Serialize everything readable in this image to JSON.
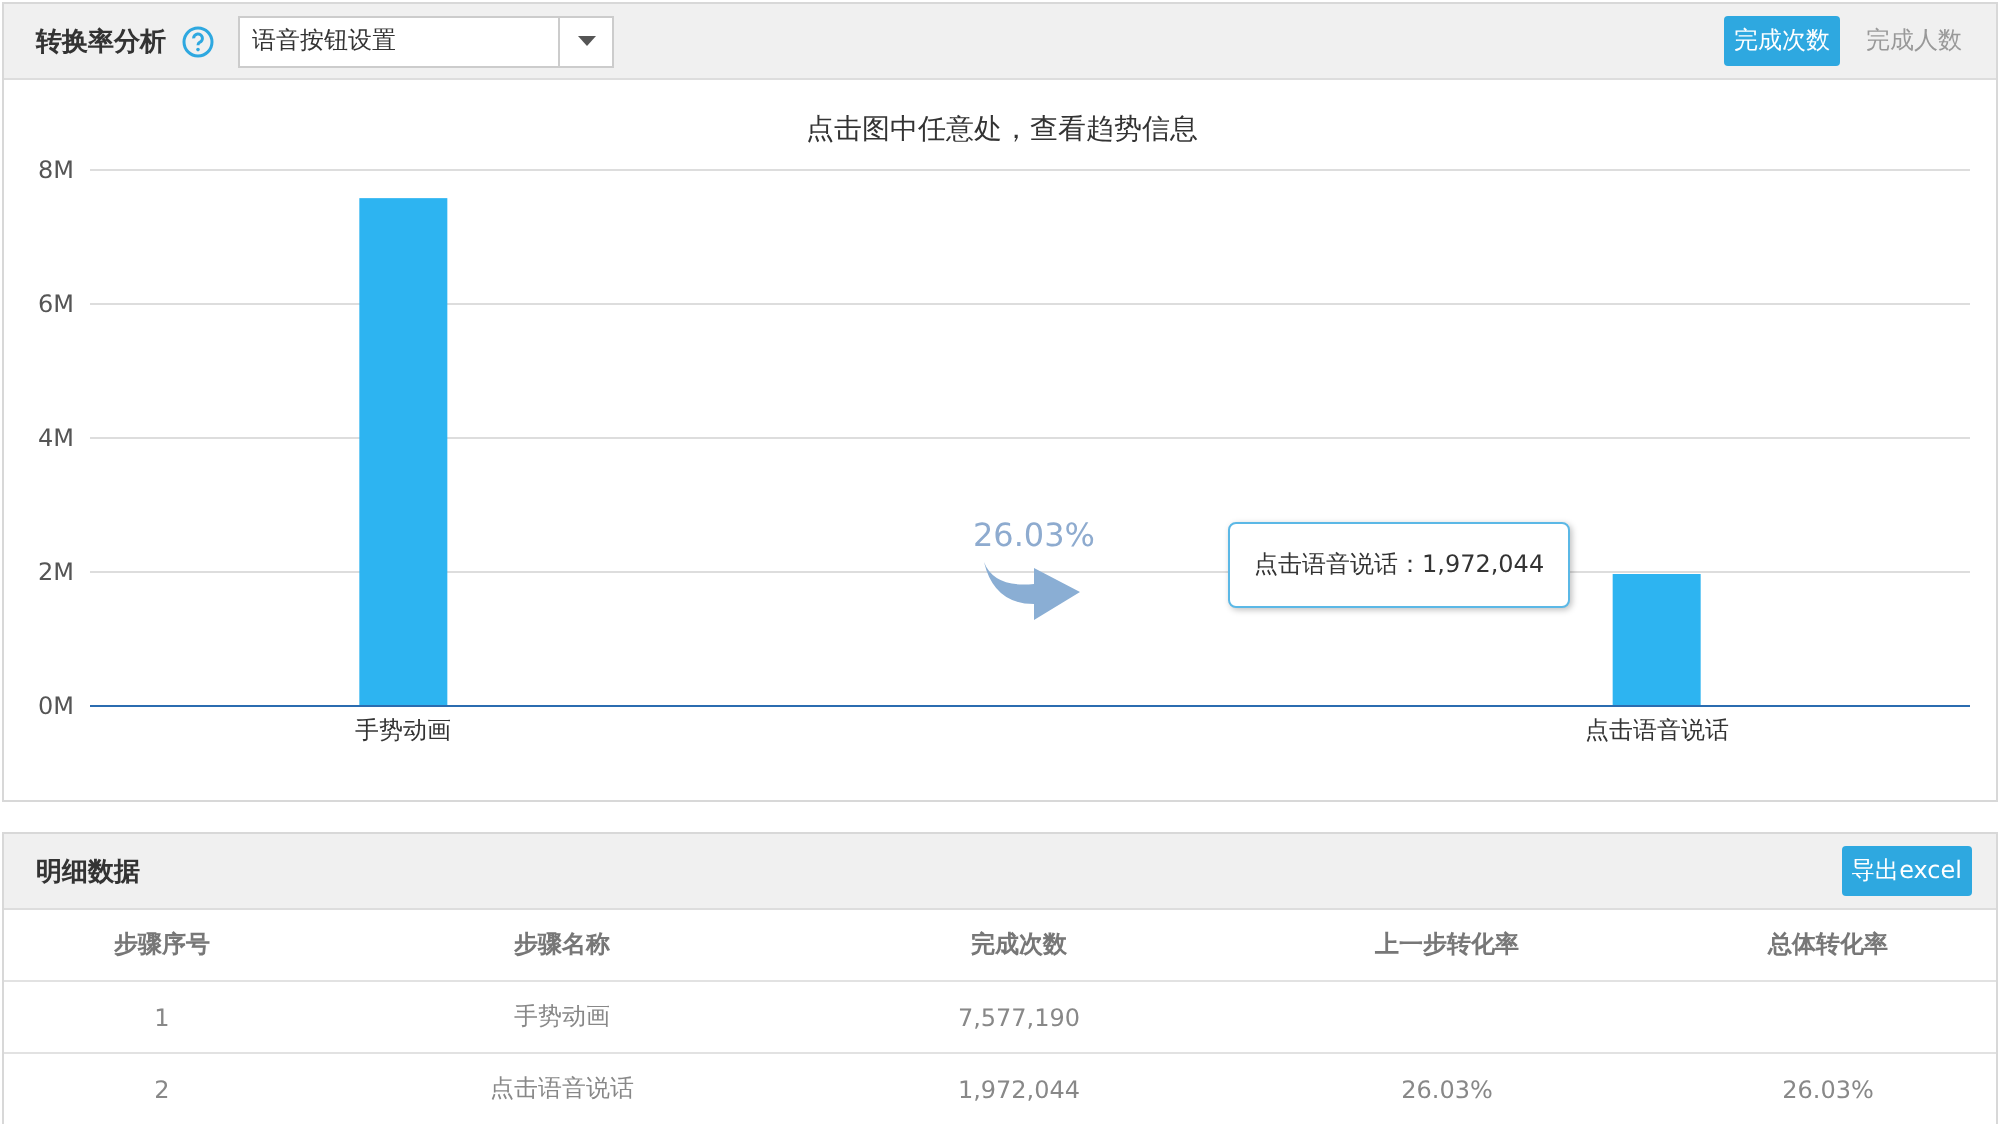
{
  "panel": {
    "title": "转换率分析",
    "select": {
      "value": "语音按钮设置"
    },
    "toggles": [
      {
        "label": "完成次数",
        "selected": true
      },
      {
        "label": "完成人数",
        "selected": false
      }
    ]
  },
  "chart": {
    "hint": "点击图中任意处，查看趋势信息",
    "tooltip": {
      "label": "点击语音说话：",
      "value": "1,972,044"
    },
    "chart_data": {
      "type": "bar",
      "categories": [
        "手势动画",
        "点击语音说话"
      ],
      "series": [
        {
          "color": "#2db4f1",
          "values": [
            7580000,
            1970000
          ]
        }
      ],
      "ylim": [
        0,
        8000000
      ],
      "grid": true,
      "yticks": [
        {
          "value": 0,
          "label": "0M"
        },
        {
          "value": 2000000,
          "label": "2M"
        },
        {
          "value": 4000000,
          "label": "4M"
        },
        {
          "value": 6000000,
          "label": "6M"
        },
        {
          "value": 8000000,
          "label": "8M"
        }
      ],
      "annotations": [
        {
          "text": "26.03%"
        }
      ]
    }
  },
  "details": {
    "title": "明细数据",
    "export_button": "导出excel",
    "columns": [
      "步骤序号",
      "步骤名称",
      "完成次数",
      "上一步转化率",
      "总体转化率"
    ],
    "rows": [
      [
        "1",
        "手势动画",
        "7,577,190",
        "",
        ""
      ],
      [
        "2",
        "点击语音说话",
        "1,972,044",
        "26.03%",
        "26.03%"
      ]
    ]
  }
}
